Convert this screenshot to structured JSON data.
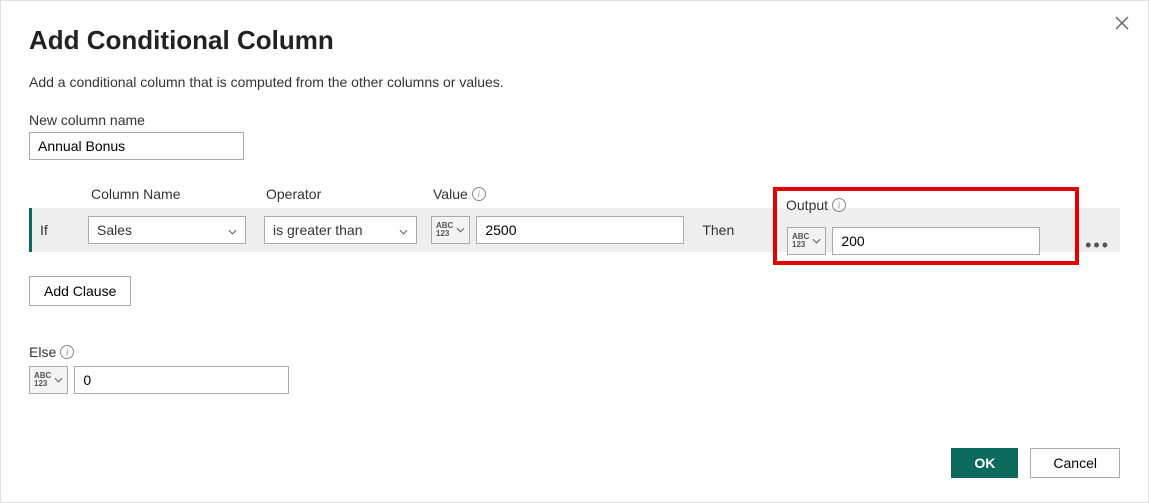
{
  "dialog": {
    "title": "Add Conditional Column",
    "subtitle": "Add a conditional column that is computed from the other columns or values."
  },
  "newColumn": {
    "label": "New column name",
    "value": "Annual Bonus"
  },
  "headers": {
    "columnName": "Column Name",
    "operator": "Operator",
    "value": "Value",
    "output": "Output"
  },
  "clause": {
    "ifLabel": "If",
    "columnName": "Sales",
    "operator": "is greater than",
    "typeLabel1": "ABC",
    "typeLabel2": "123",
    "value": "2500",
    "thenLabel": "Then",
    "outputTypeLabel1": "ABC",
    "outputTypeLabel2": "123",
    "output": "200"
  },
  "addClause": {
    "label": "Add Clause"
  },
  "else": {
    "label": "Else",
    "typeLabel1": "ABC",
    "typeLabel2": "123",
    "value": "0"
  },
  "buttons": {
    "ok": "OK",
    "cancel": "Cancel"
  }
}
